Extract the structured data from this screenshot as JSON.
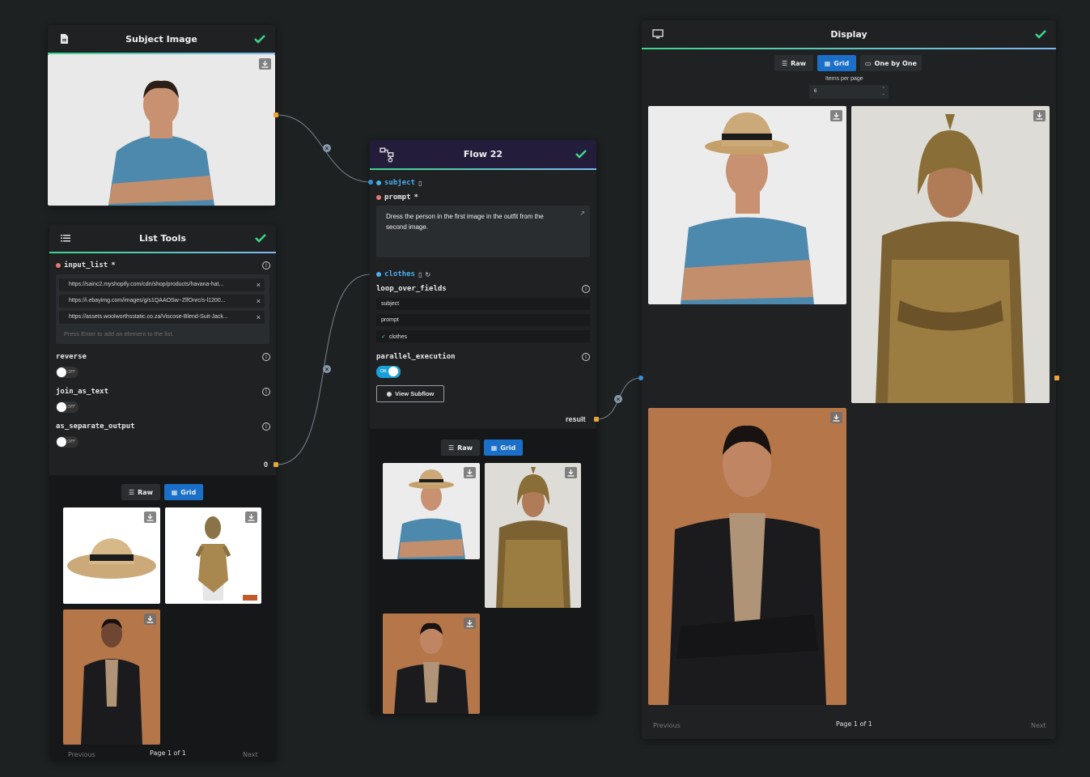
{
  "subject_node": {
    "title": "Subject Image"
  },
  "list_node": {
    "title": "List Tools",
    "input_list_label": "input_list",
    "items": [
      "https://sainc2.myshopify.com/cdn/shop/products/havana-hat...",
      "https://i.ebayimg.com/images/g/s1QAAOSw~ZlfOnrc/s-l1200...",
      "https://assets.woolworthsstatic.co.za/Viscose-Blend-Suit-Jack..."
    ],
    "input_placeholder": "Press Enter to add an element to the list.",
    "reverse_label": "reverse",
    "join_label": "join_as_text",
    "separate_label": "as_separate_output",
    "off_text": "OFF",
    "output_count": "0",
    "raw_label": "Raw",
    "grid_label": "Grid",
    "prev_label": "Previous",
    "page_label": "Page 1 of 1",
    "next_label": "Next"
  },
  "flow_node": {
    "title": "Flow 22",
    "subject_label": "subject",
    "prompt_label": "prompt",
    "prompt_value": "Dress the person in the first image in the outfit from the second image.",
    "clothes_label": "clothes",
    "loop_label": "loop_over_fields",
    "loop_options": [
      "subject",
      "prompt",
      "clothes"
    ],
    "parallel_label": "parallel_execution",
    "on_text": "ON",
    "view_subflow_label": "View Subflow",
    "result_label": "result",
    "raw_label": "Raw",
    "grid_label": "Grid"
  },
  "display_node": {
    "title": "Display",
    "raw_label": "Raw",
    "grid_label": "Grid",
    "one_by_one_label": "One by One",
    "items_per_page_label": "Items per page",
    "items_per_page_value": "6",
    "prev_label": "Previous",
    "page_label": "Page 1 of 1",
    "next_label": "Next"
  },
  "colors": {
    "canvas": "#1d2121",
    "node": "#1f2123",
    "accent_blue": "#1a6fc9",
    "check_green": "#3dd68c",
    "port_orange": "#e8a33d",
    "toggle_on": "#1aa0d8",
    "flow_header": "#231c3b"
  },
  "icons": [
    "document-icon",
    "list-icon",
    "flow-icon",
    "monitor-icon",
    "check-icon",
    "download-icon",
    "info-icon",
    "external-link-icon",
    "grid-icon",
    "eye-icon",
    "refresh-icon"
  ]
}
